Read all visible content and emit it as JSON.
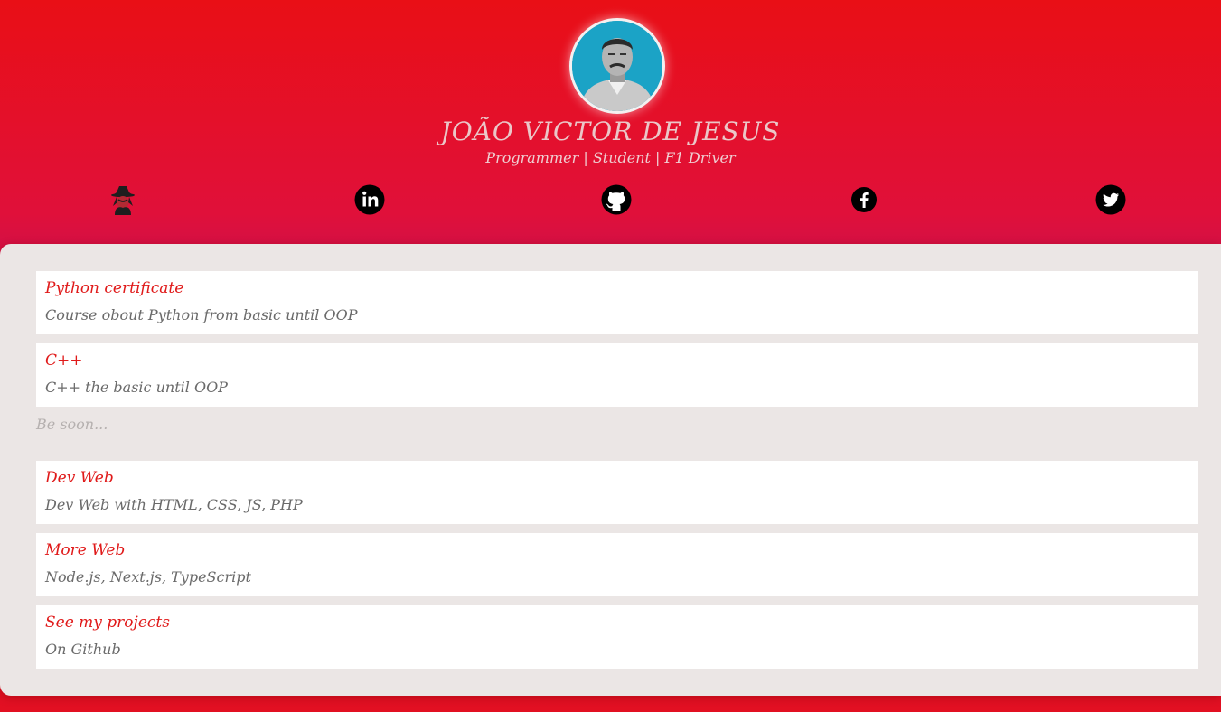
{
  "profile": {
    "name": "JOÃO VICTOR DE JESUS",
    "tagline": "Programmer | Student | F1 Driver",
    "avatar_icon": "profile-photo"
  },
  "social_links": [
    {
      "icon": "hacker-icon",
      "label": ""
    },
    {
      "icon": "linkedin-icon",
      "label": ""
    },
    {
      "icon": "github-icon",
      "label": ""
    },
    {
      "icon": "facebook-icon",
      "label": ""
    },
    {
      "icon": "twitter-icon",
      "label": ""
    }
  ],
  "cards_group_1": [
    {
      "title": "Python certificate",
      "description": "Course obout Python from basic until OOP"
    },
    {
      "title": "C++",
      "description": "C++ the basic until OOP"
    }
  ],
  "soon_text": "Be soon...",
  "cards_group_2": [
    {
      "title": "Dev Web",
      "description": "Dev Web with HTML, CSS, JS, PHP"
    },
    {
      "title": "More Web",
      "description": "Node.js, Next.js, TypeScript"
    },
    {
      "title": "See my projects",
      "description": "On Github"
    }
  ],
  "colors": {
    "background_red": "#e90f16",
    "card_title": "#e01a1a",
    "card_text": "#6a6a6a",
    "panel": "#ebe6e5"
  }
}
